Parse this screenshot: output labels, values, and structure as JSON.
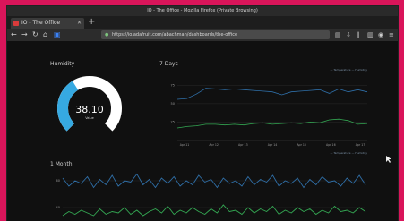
{
  "browser": {
    "window_title": "IO - The Office - Mozilla Firefox (Private Browsing)",
    "tab_title": "IO - The Office",
    "url": "https://io.adafruit.com/abachman/dashboards/the-office"
  },
  "humidity": {
    "title": "Humidity",
    "value": "38.10",
    "unit": "Value",
    "fraction": 0.381,
    "colors": {
      "fill": "#36a9e1",
      "track": "#ffffff"
    }
  },
  "week_chart": {
    "title": "7 Days",
    "legend_top": "— Temperature  — Humidity",
    "legend_bottom": "— Temperature  — Humidity",
    "y_ticks": [
      "75",
      "50",
      "25"
    ],
    "x_ticks": [
      "Apr 11",
      "Apr 12",
      "Apr 13",
      "Apr 14",
      "Apr 15",
      "Apr 16",
      "Apr 17"
    ]
  },
  "month_chart": {
    "title": "1 Month",
    "y_ticks": [
      "60",
      "40"
    ]
  },
  "chart_data": [
    {
      "type": "line",
      "title": "7 Days",
      "x": [
        "Apr 11",
        "Apr 12",
        "Apr 13",
        "Apr 14",
        "Apr 15",
        "Apr 16",
        "Apr 17"
      ],
      "ylim": [
        0,
        90
      ],
      "series": [
        {
          "name": "Temperature",
          "color": "#2f6fa8",
          "values": [
            56,
            57,
            63,
            71,
            70,
            69,
            70,
            69,
            68,
            67,
            66,
            62,
            66,
            67,
            68,
            69,
            64,
            70,
            66,
            69,
            66
          ]
        },
        {
          "name": "Humidity",
          "color": "#34a853",
          "values": [
            17,
            19,
            20,
            22,
            22,
            21,
            22,
            21,
            23,
            24,
            22,
            23,
            24,
            23,
            25,
            24,
            28,
            29,
            27,
            22,
            23
          ]
        }
      ]
    },
    {
      "type": "line",
      "title": "1 Month",
      "ylim": [
        30,
        70
      ],
      "series": [
        {
          "color": "#2f6fa8",
          "values": [
            62,
            56,
            60,
            58,
            63,
            55,
            61,
            57,
            64,
            56,
            60,
            59,
            65,
            57,
            61,
            55,
            62,
            58,
            63,
            56,
            60,
            57,
            64,
            59,
            61,
            55,
            62,
            58,
            60,
            56,
            63,
            57,
            61,
            59,
            64,
            56,
            60,
            58,
            62,
            55,
            61,
            57,
            63,
            59,
            60,
            56,
            62,
            58,
            64,
            57
          ]
        },
        {
          "color": "#34a853",
          "values": [
            34,
            37,
            35,
            38,
            36,
            34,
            39,
            35,
            37,
            36,
            40,
            35,
            38,
            34,
            37,
            39,
            36,
            41,
            35,
            38,
            36,
            40,
            37,
            35,
            39,
            36,
            42,
            37,
            38,
            35,
            40,
            36,
            39,
            37,
            41,
            35,
            38,
            36,
            40,
            37,
            39,
            35,
            38,
            36,
            41,
            37,
            38,
            36,
            40,
            37
          ]
        }
      ]
    }
  ]
}
